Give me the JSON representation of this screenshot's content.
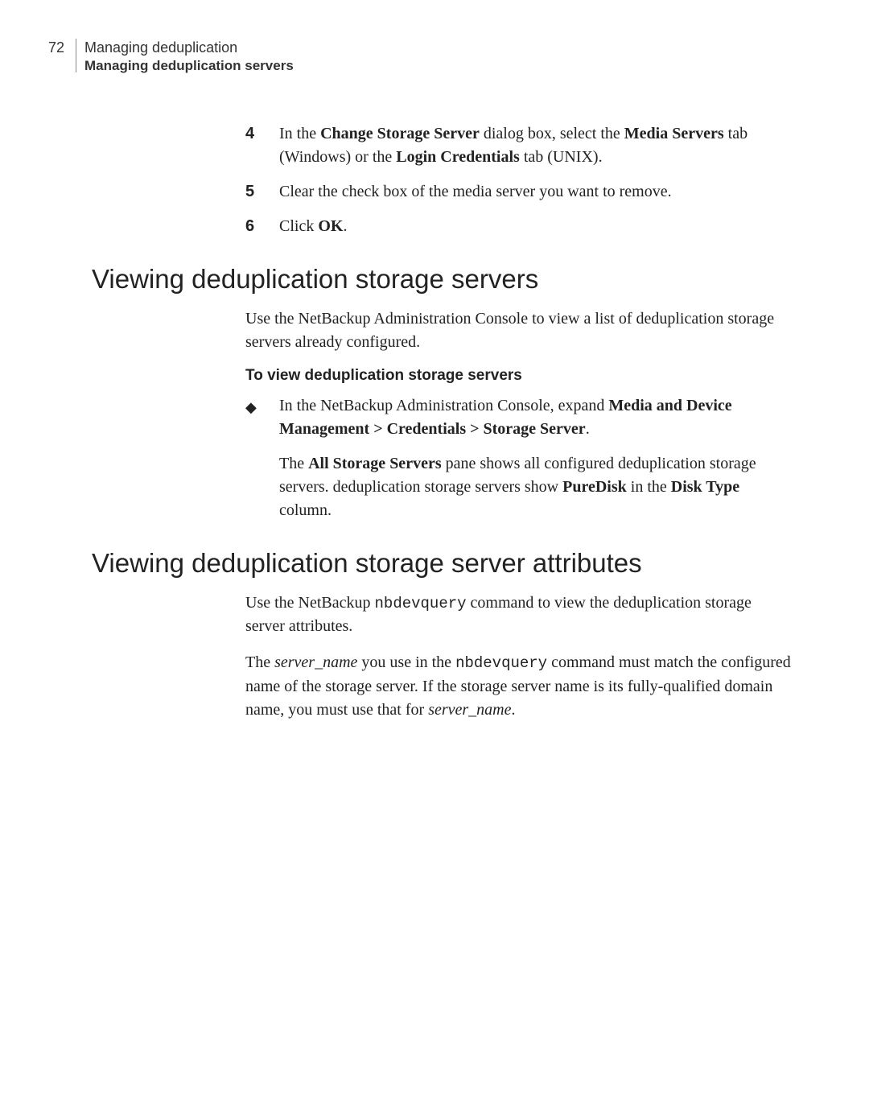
{
  "header": {
    "page_number": "72",
    "chapter": "Managing deduplication",
    "section": "Managing deduplication servers"
  },
  "steps": {
    "s4_num": "4",
    "s4_a": "In the ",
    "s4_b": "Change Storage Server",
    "s4_c": " dialog box, select the ",
    "s4_d": "Media Servers",
    "s4_e": " tab (Windows) or the ",
    "s4_f": "Login Credentials",
    "s4_g": " tab (UNIX).",
    "s5_num": "5",
    "s5": "Clear the check box of the media server you want to remove.",
    "s6_num": "6",
    "s6_a": "Click ",
    "s6_b": "OK",
    "s6_c": "."
  },
  "sec1": {
    "heading": "Viewing deduplication storage servers",
    "p1": "Use the NetBackup Administration Console to view a list of deduplication storage servers already configured.",
    "sub": "To view deduplication storage servers",
    "b1_a": "In the NetBackup Administration Console, expand ",
    "b1_b": "Media and Device Management > Credentials > Storage Server",
    "b1_c": ".",
    "b2_a": "The ",
    "b2_b": "All Storage Servers",
    "b2_c": " pane shows all configured deduplication storage servers. deduplication storage servers show ",
    "b2_d": "PureDisk",
    "b2_e": " in the ",
    "b2_f": "Disk Type",
    "b2_g": " column."
  },
  "sec2": {
    "heading": "Viewing deduplication storage server attributes",
    "p1_a": "Use the NetBackup ",
    "p1_b": "nbdevquery",
    "p1_c": " command to view the deduplication storage server attributes.",
    "p2_a": "The ",
    "p2_b": "server_name",
    "p2_c": " you use in the ",
    "p2_d": "nbdevquery",
    "p2_e": " command must match the configured name of the storage server. If the storage server name is its fully-qualified domain name, you must use that for ",
    "p2_f": "server_name",
    "p2_g": "."
  }
}
